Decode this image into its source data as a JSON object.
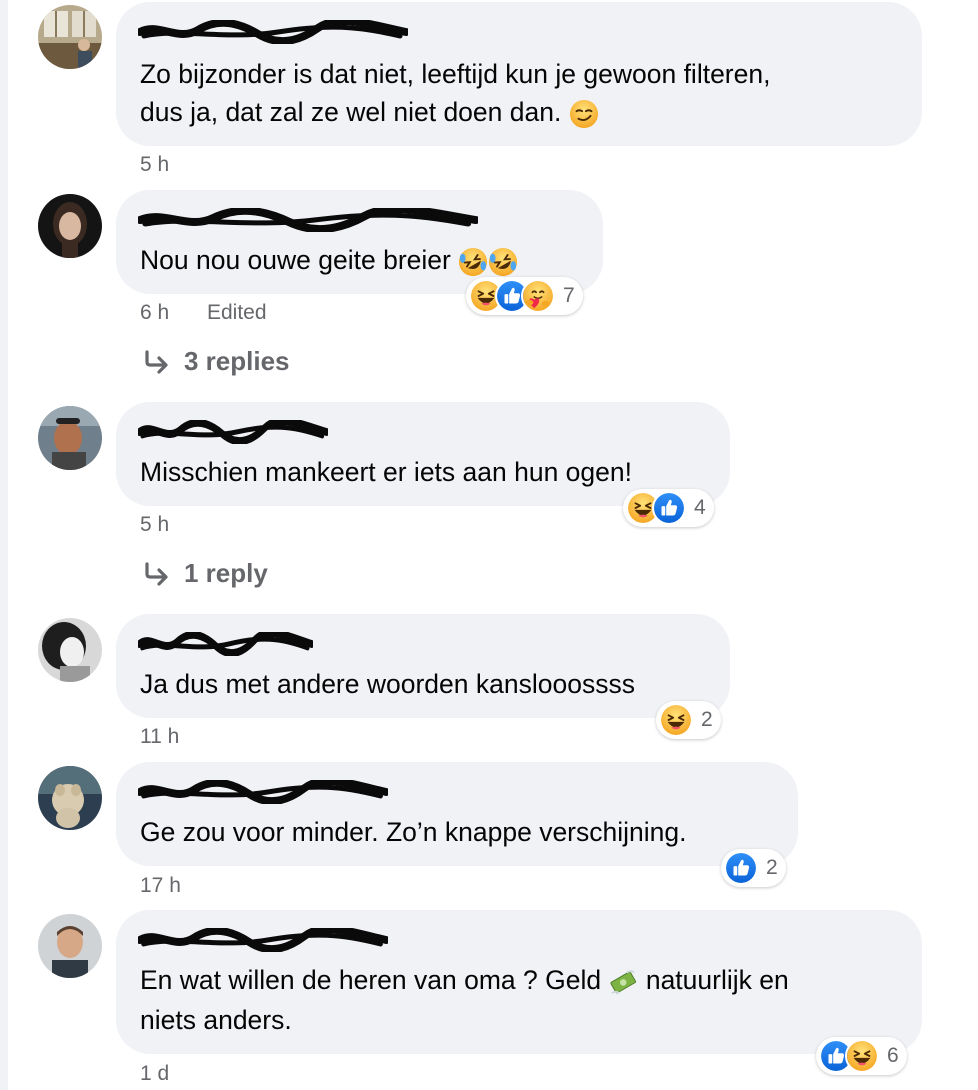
{
  "comments": [
    {
      "text": "Zo bijzonder is dat niet, leeftijd kun je gewoon filteren,",
      "text2": "dus ja, dat zal ze wel niet doen dan.",
      "time": "5 h"
    },
    {
      "text": "Nou nou ouwe geite breier",
      "time": "6 h",
      "edited": "Edited",
      "reactions": {
        "icons": [
          "haha-icon",
          "like-icon",
          "care-icon"
        ],
        "count": "7"
      },
      "replies": "3 replies"
    },
    {
      "text": "Misschien mankeert er iets aan hun ogen!",
      "time": "5 h",
      "reactions": {
        "icons": [
          "haha-icon",
          "like-icon"
        ],
        "count": "4"
      },
      "replies": "1 reply"
    },
    {
      "text": "Ja dus met andere woorden kanslooossss",
      "time": "11 h",
      "reactions": {
        "icons": [
          "haha-icon"
        ],
        "count": "2"
      }
    },
    {
      "text": "Ge zou voor minder. Zo’n knappe verschijning.",
      "time": "17 h",
      "reactions": {
        "icons": [
          "like-icon"
        ],
        "count": "2"
      }
    },
    {
      "text": "En wat willen de heren van oma ? Geld",
      "text_after": "natuurlijk en",
      "text2": "niets anders.",
      "time": "1 d",
      "reactions": {
        "icons": [
          "like-icon",
          "haha-icon"
        ],
        "count": "6"
      }
    }
  ],
  "colors": {
    "bubble": "#f0f2f5",
    "meta_text": "#65676b",
    "like_blue": "#1877f2",
    "haha_yellow": "#f7b125"
  }
}
